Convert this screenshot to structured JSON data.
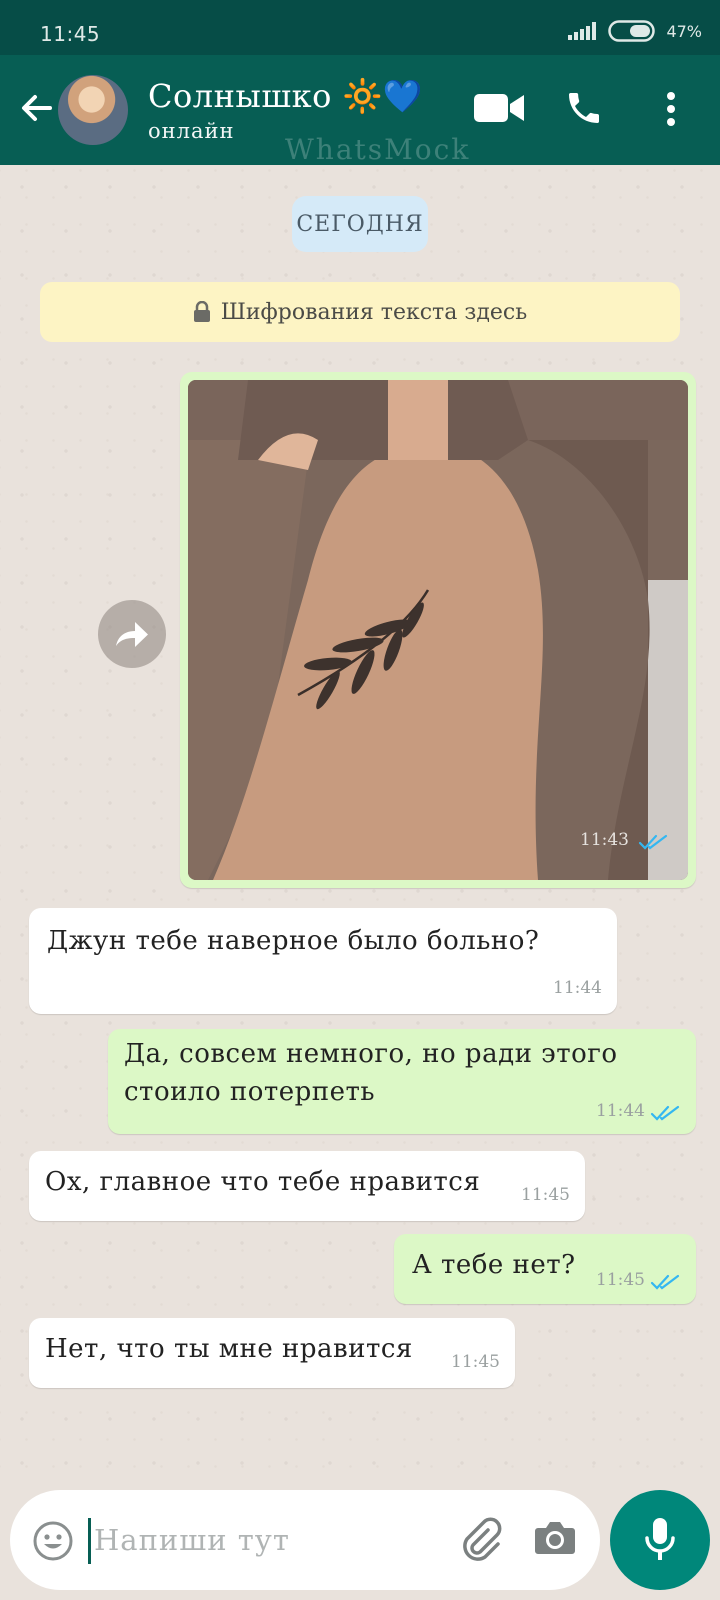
{
  "status_bar": {
    "time": "11:45",
    "battery": "47%"
  },
  "header": {
    "contact_name": "Солнышко 🔆💙",
    "contact_status": "онлайн",
    "watermark": "WhatsMock"
  },
  "date_separator": "СЕГОДНЯ",
  "encryption_notice": "Шифрования текста здесь",
  "messages": [
    {
      "direction": "outgoing",
      "type": "image",
      "time": "11:43",
      "read": true
    },
    {
      "direction": "incoming",
      "text": "Джун тебе наверное было больно?",
      "time": "11:44"
    },
    {
      "direction": "outgoing",
      "text": "Да, совсем немного, но ради этого стоило потерпеть",
      "time": "11:44",
      "read": true
    },
    {
      "direction": "incoming",
      "text": "Ох, главное что тебе нравится",
      "time": "11:45"
    },
    {
      "direction": "outgoing",
      "text": "А тебе нет?",
      "time": "11:45",
      "read": true
    },
    {
      "direction": "incoming",
      "text": "Нет, что ты мне нравится",
      "time": "11:45"
    }
  ],
  "input": {
    "placeholder": "Напиши тут"
  },
  "icons": [
    "back-arrow-icon",
    "video-call-icon",
    "phone-icon",
    "more-options-icon",
    "lock-icon",
    "forward-icon",
    "emoji-icon",
    "attach-icon",
    "camera-icon",
    "mic-icon",
    "double-check-icon"
  ],
  "colors": {
    "header": "#075e54",
    "status_bar": "#064d47",
    "outgoing_bubble": "#dcf8c6",
    "incoming_bubble": "#ffffff",
    "read_ticks": "#34b7f1",
    "mic_button": "#00877a"
  }
}
